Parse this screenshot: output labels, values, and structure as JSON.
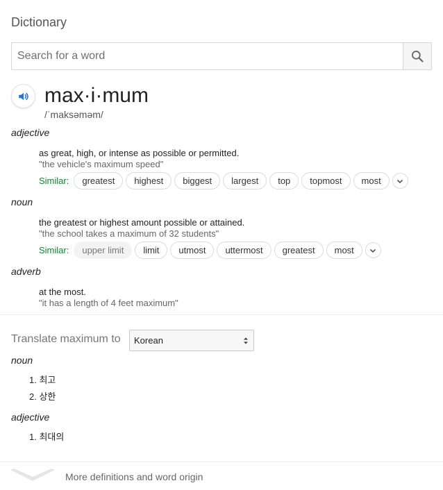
{
  "header": {
    "title": "Dictionary"
  },
  "search": {
    "placeholder": "Search for a word",
    "icon": "search-icon"
  },
  "entry": {
    "word": "max·i·mum",
    "phonetic": "/ˈmaksəməm/",
    "senses": [
      {
        "pos": "adjective",
        "definition": "as great, high, or intense as possible or permitted.",
        "example": "\"the vehicle's maximum speed\"",
        "similar_label": "Similar:",
        "similar": [
          "greatest",
          "highest",
          "biggest",
          "largest",
          "top",
          "topmost",
          "most"
        ]
      },
      {
        "pos": "noun",
        "definition": "the greatest or highest amount possible or attained.",
        "example": "\"the school takes a maximum of 32 students\"",
        "similar_label": "Similar:",
        "similar_plain": "upper limit",
        "similar": [
          "limit",
          "utmost",
          "uttermost",
          "greatest",
          "most"
        ]
      },
      {
        "pos": "adverb",
        "definition": "at the most.",
        "example": "\"it has a length of 4 feet maximum\""
      }
    ]
  },
  "translate": {
    "label": "Translate maximum to",
    "language": "Korean",
    "groups": [
      {
        "pos": "noun",
        "items": [
          "1. 최고",
          "2. 상한"
        ]
      },
      {
        "pos": "adjective",
        "items": [
          "1. 최대의"
        ]
      }
    ]
  },
  "footer": {
    "more_label": "More definitions and word origin"
  },
  "colors": {
    "accent": "#1a73e8",
    "similar_green": "#188038"
  }
}
